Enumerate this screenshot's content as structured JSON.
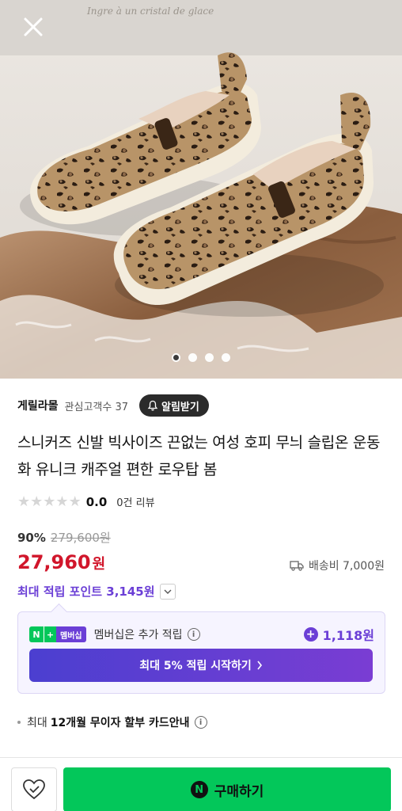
{
  "hero": {
    "watermark_text": "Ingre à un cristal de glace",
    "slide_count": 4,
    "active_slide": 1
  },
  "seller": {
    "name": "게릴라몰",
    "followers_label": "관심고객수 37",
    "alarm_label": "알림받기"
  },
  "product": {
    "title": "스니커즈 신발 빅사이즈 끈없는 여성 호피 무늬 슬립온 운동화 유니크 캐주얼 편한 로우탑 봄"
  },
  "rating": {
    "stars": 0,
    "score": "0.0",
    "reviews": "0건 리뷰"
  },
  "price": {
    "discount": "90%",
    "original": "279,600원",
    "sale_number": "27,960",
    "sale_unit": "원",
    "shipping": "배송비 7,000원"
  },
  "points": {
    "label": "최대 적립 포인트 3,145원"
  },
  "membership": {
    "badge_n": "N",
    "badge_plus": "+",
    "badge_label": "멤버십",
    "text": "멤버십은 추가 적립",
    "points": "1,118원",
    "cta": "최대 5% 적립 시작하기"
  },
  "installment": {
    "prefix": "최대",
    "text": "12개월 무이자 할부 카드안내"
  },
  "bottom": {
    "buy_label": "구매하기",
    "buy_icon": "N"
  },
  "colors": {
    "price_red": "#d1162b",
    "points_purple": "#6b3fd6",
    "naver_green": "#03c75a"
  }
}
